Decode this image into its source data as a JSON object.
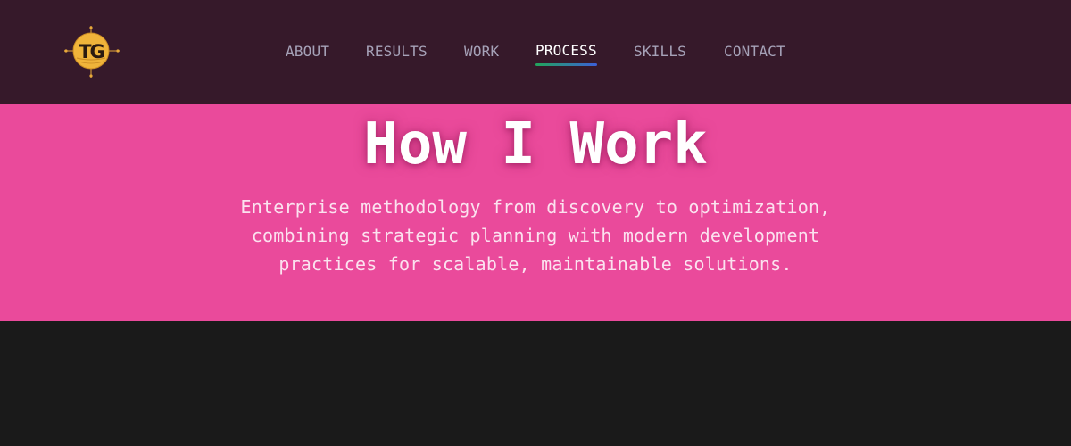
{
  "nav": {
    "logo_text": "TG",
    "items": [
      {
        "label": "ABOUT"
      },
      {
        "label": "RESULTS"
      },
      {
        "label": "WORK"
      },
      {
        "label": "PROCESS"
      },
      {
        "label": "SKILLS"
      },
      {
        "label": "CONTACT"
      }
    ],
    "active": "PROCESS"
  },
  "hero": {
    "title": "How I Work",
    "subtitle": "Enterprise methodology from discovery to optimization, combining strategic planning with modern development practices for scalable, maintainable solutions."
  },
  "colors": {
    "navbar_bg": "#36192a",
    "hero_bg": "#ea4a9b",
    "page_bg": "#1a1a1a",
    "nav_text": "#a6a2b8",
    "nav_active": "#ffffff",
    "underline_start": "#22a55b",
    "underline_end": "#3c5fd8",
    "logo_gold": "#f0b43a"
  }
}
